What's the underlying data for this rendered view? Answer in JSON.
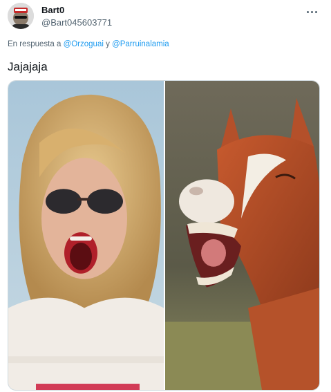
{
  "author": {
    "display_name": "Bart0",
    "handle": "@Bart045603771",
    "avatar_icon": "user-avatar"
  },
  "more_icon": "more-horizontal-icon",
  "reply": {
    "prefix": "En respuesta a",
    "mention_1": "@Orzoguai",
    "connector": "y",
    "mention_2": "@Parruinalamia"
  },
  "tweet": {
    "text": "Jajajaja"
  },
  "media": {
    "left_image": "woman-laughing-photo",
    "right_image": "horse-laughing-photo"
  },
  "colors": {
    "link": "#1d9bf0",
    "secondary_text": "#536471",
    "primary_text": "#0f1419"
  }
}
